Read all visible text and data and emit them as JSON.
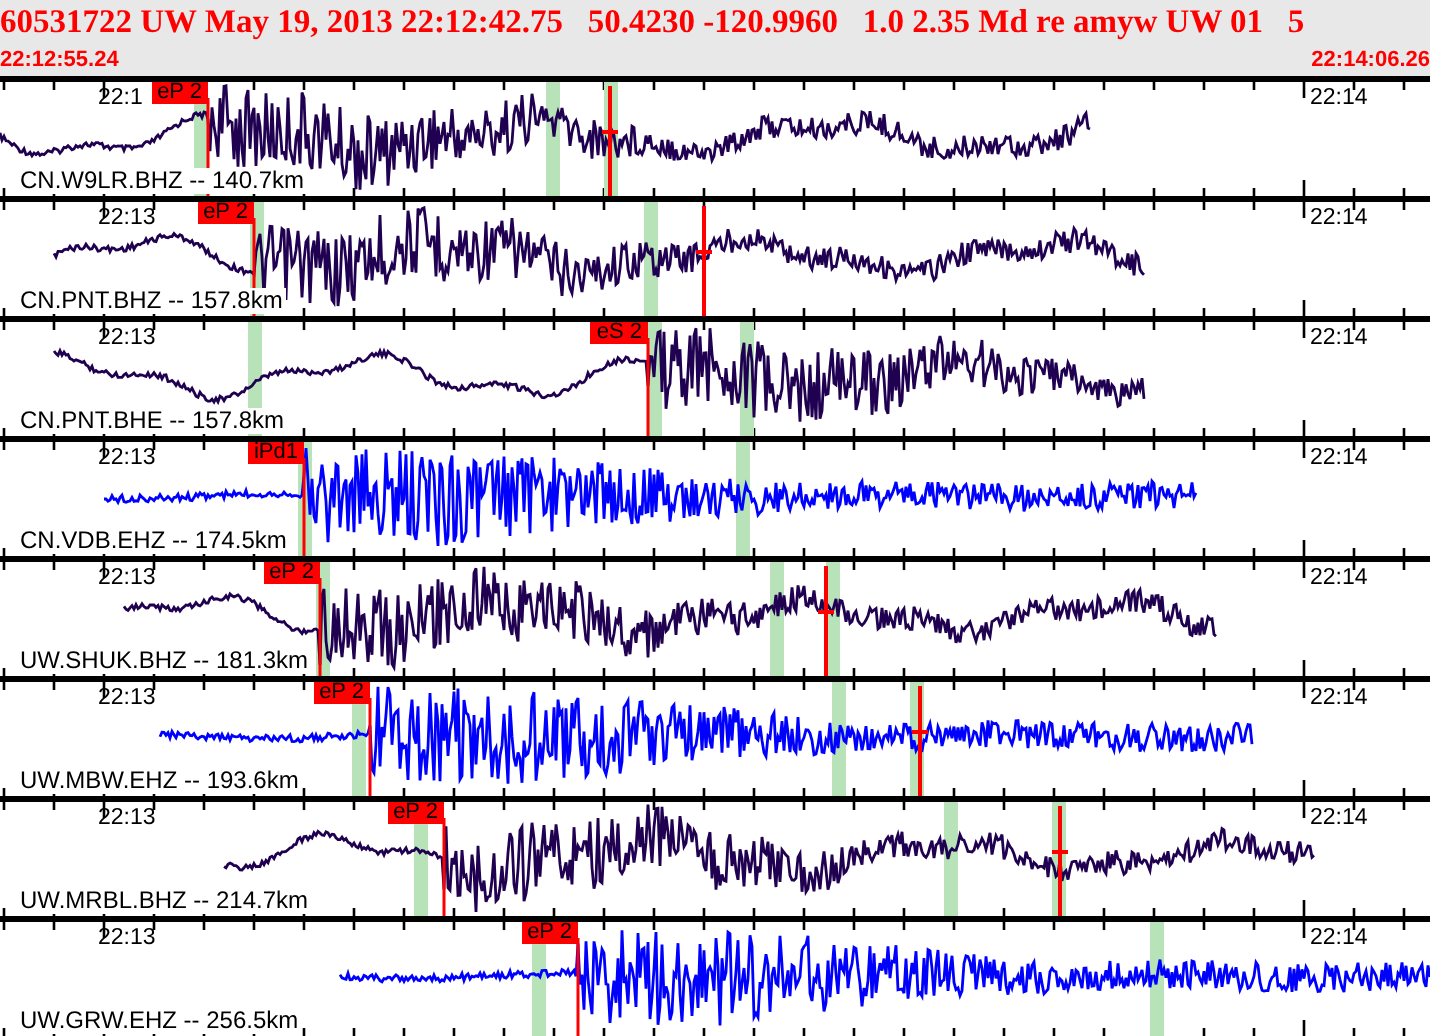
{
  "header": {
    "event_line": "60531722 UW May 19, 2013 22:12:42.75   50.4230 -120.9960   1.0 2.35 Md re amyw UW 01   5",
    "start_time": "22:12:55.24",
    "end_time": "22:14:06.26"
  },
  "traces": [
    {
      "channel": "CN.W9LR.BHZ -- 140.7km",
      "color": "#200050",
      "pick": "eP 2",
      "time_left": "22:1",
      "time_right": "22:14"
    },
    {
      "channel": "CN.PNT.BHZ -- 157.8km",
      "color": "#200050",
      "pick": "eP 2",
      "time_left": "22:13",
      "time_right": "22:14"
    },
    {
      "channel": "CN.PNT.BHE -- 157.8km",
      "color": "#200050",
      "pick": "eS 2",
      "time_left": "22:13",
      "time_right": "22:14"
    },
    {
      "channel": "CN.VDB.EHZ -- 174.5km",
      "color": "#0000ff",
      "pick": "iPd1",
      "time_left": "22:13",
      "time_right": "22:14"
    },
    {
      "channel": "UW.SHUK.BHZ -- 181.3km",
      "color": "#200050",
      "pick": "eP 2",
      "time_left": "22:13",
      "time_right": "22:14"
    },
    {
      "channel": "UW.MBW.EHZ -- 193.6km",
      "color": "#0000ff",
      "pick": "eP 2",
      "time_left": "22:13",
      "time_right": "22:14"
    },
    {
      "channel": "UW.MRBL.BHZ -- 214.7km",
      "color": "#200050",
      "pick": "eP 2",
      "time_left": "22:13",
      "time_right": "22:14"
    },
    {
      "channel": "UW.GRW.EHZ -- 256.5km",
      "color": "#0000ff",
      "pick": "eP 2",
      "time_left": "22:13",
      "time_right": "22:14"
    }
  ]
}
